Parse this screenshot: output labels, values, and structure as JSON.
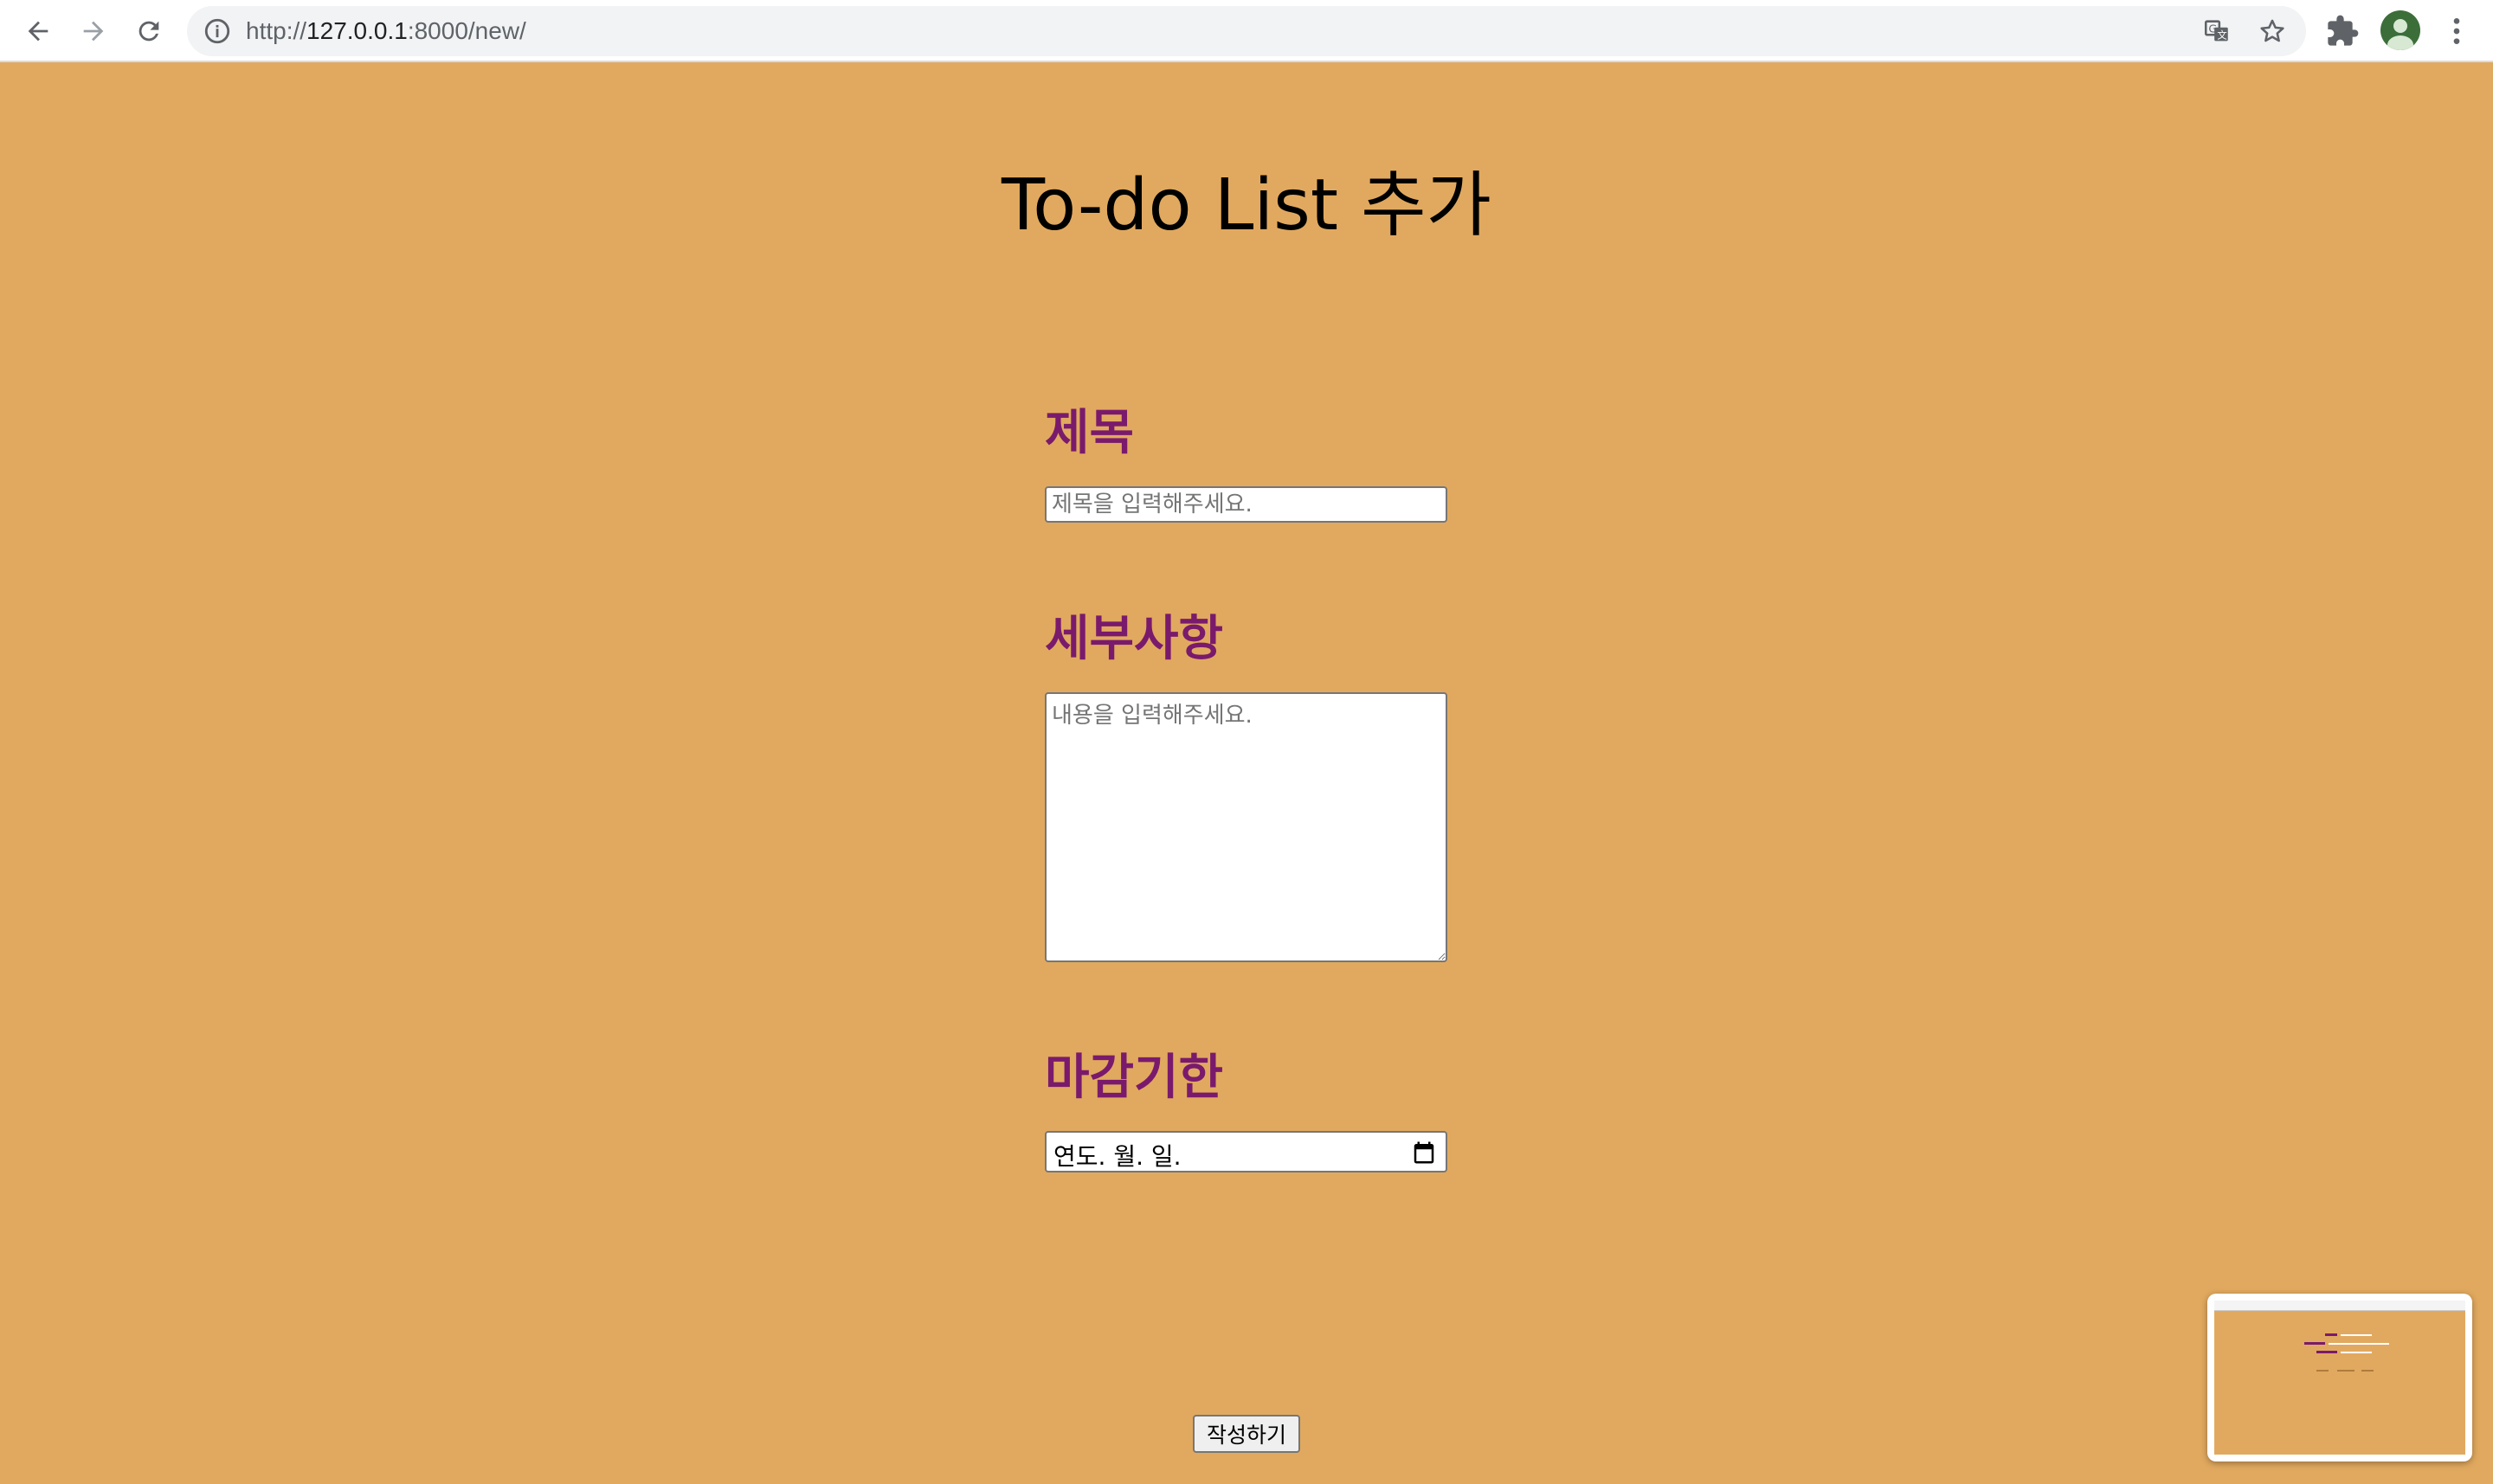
{
  "browser": {
    "url_prefix": "http://",
    "url_host": "127.0.0.1",
    "url_rest": ":8000/new/",
    "icons": [
      "back-arrow-icon",
      "forward-arrow-icon",
      "reload-icon",
      "info-icon",
      "translate-icon",
      "star-icon",
      "extensions-icon",
      "profile-avatar-icon",
      "more-vert-icon"
    ]
  },
  "page": {
    "title": "To-do List 추가",
    "background": "#e1a95f",
    "label_color": "#7a1a6c"
  },
  "form": {
    "title_label": "제목",
    "title_placeholder": "제목을 입력해주세요.",
    "title_value": "",
    "details_label": "세부사항",
    "details_placeholder": "내용을 입력해주세요.",
    "details_value": "",
    "deadline_label": "마감기한",
    "deadline_display": "연도. 월. 일.",
    "submit_label": "작성하기"
  }
}
